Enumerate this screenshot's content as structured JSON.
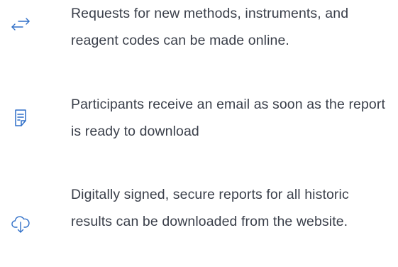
{
  "colors": {
    "icon": "#2f6fc8",
    "text": "#3a3f4a",
    "background": "#ffffff"
  },
  "features": [
    {
      "icon": "bidirectional-arrows-icon",
      "text": "Requests for new methods, instruments, and reagent codes can be made online."
    },
    {
      "icon": "document-report-icon",
      "text": "Participants receive an email as soon as the report is ready to download"
    },
    {
      "icon": "cloud-download-icon",
      "text": "Digitally signed, secure reports for all historic results can be downloaded from the website."
    }
  ]
}
